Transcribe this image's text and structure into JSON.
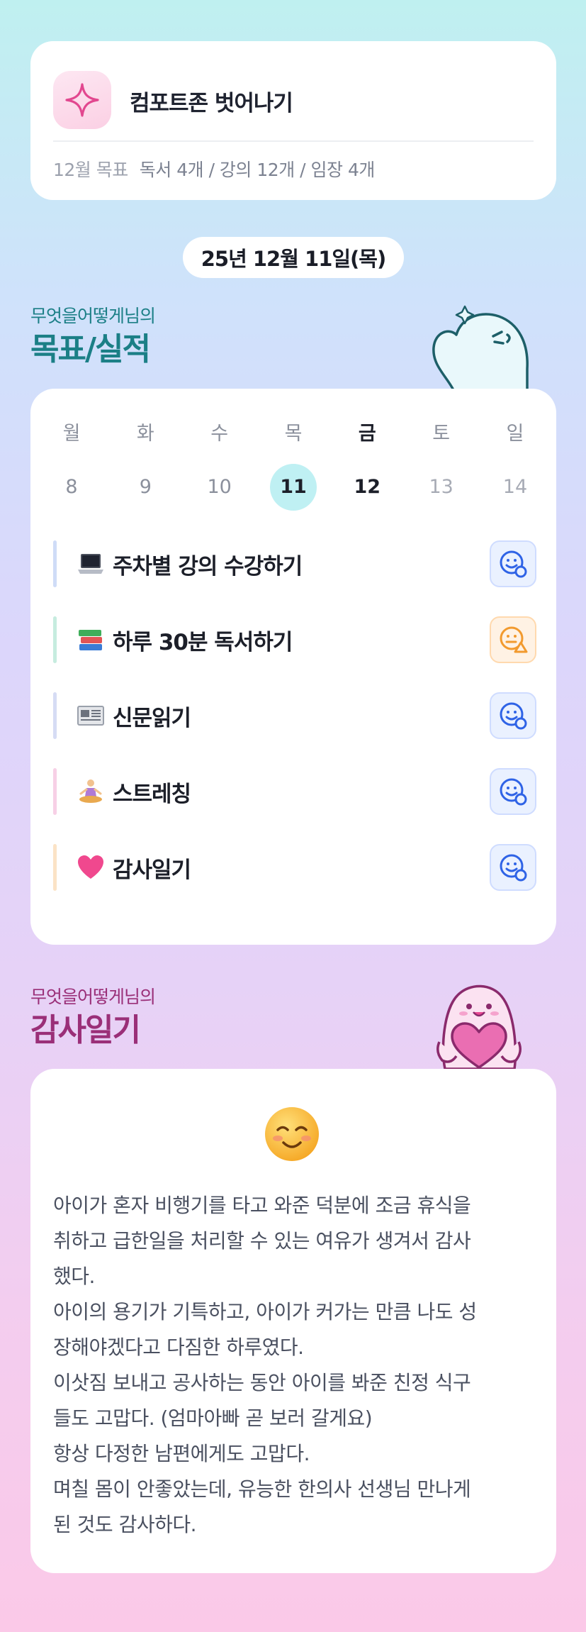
{
  "challenge": {
    "title": "컴포트존 벗어나기",
    "goal_label": "12월 목표",
    "goal_text": "독서 4개 / 강의 12개 / 임장 4개"
  },
  "date_label": "25년 12월 11일(목)",
  "goals_section": {
    "subtitle": "무엇을어떻게님의",
    "title": "목표/실적"
  },
  "week": [
    {
      "weekday": "월",
      "day": "8"
    },
    {
      "weekday": "화",
      "day": "9"
    },
    {
      "weekday": "수",
      "day": "10"
    },
    {
      "weekday": "목",
      "day": "11"
    },
    {
      "weekday": "금",
      "day": "12"
    },
    {
      "weekday": "토",
      "day": "13"
    },
    {
      "weekday": "일",
      "day": "14"
    }
  ],
  "tasks": [
    {
      "emoji": "laptop-icon",
      "label": "주차별 강의 수강하기",
      "bar_color": "#cfdcf7",
      "status": "smile-check"
    },
    {
      "emoji": "books-icon",
      "label": "하루 30분 독서하기",
      "bar_color": "#c6ecdf",
      "status": "neutral-warning"
    },
    {
      "emoji": "newspaper-icon",
      "label": "신문읽기",
      "bar_color": "#d6dcf4",
      "status": "smile-check"
    },
    {
      "emoji": "meditation-icon",
      "label": "스트레칭",
      "bar_color": "#f7d0e6",
      "status": "smile-check"
    },
    {
      "emoji": "heart-icon",
      "label": "감사일기",
      "bar_color": "#fbe3c6",
      "status": "smile-check"
    }
  ],
  "diary_section": {
    "subtitle": "무엇을어떻게님의",
    "title": "감사일기"
  },
  "diary": {
    "mood_icon": "smiling-face-icon",
    "lines": [
      "아이가 혼자 비행기를 타고 와준 덕분에 조금 휴식을",
      "취하고 급한일을 처리할 수 있는 여유가 생겨서 감사",
      "했다.",
      "아이의 용기가 기특하고, 아이가 커가는 만큼 나도 성",
      "장해야겠다고 다짐한 하루였다.",
      "이삿짐 보내고 공사하는 동안 아이를 봐준 친정 식구",
      "들도 고맙다. (엄마아빠 곧 보러 갈게요)",
      "항상 다정한 남편에게도 고맙다.",
      "며칠 몸이 안좋았는데, 유능한 한의사 선생님 만나게",
      "된 것도 감사하다."
    ]
  },
  "colors": {
    "accent_teal": "#1b7f86",
    "accent_plum": "#9a2f78",
    "today_highlight": "#bff0f3",
    "status_blue": "#2f63e6",
    "status_orange": "#f29a2e"
  }
}
